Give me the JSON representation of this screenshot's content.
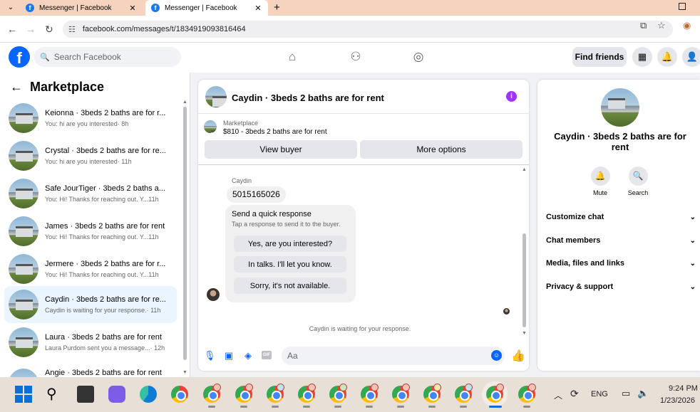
{
  "browser": {
    "tabs": [
      {
        "title": "Messenger | Facebook",
        "active": false
      },
      {
        "title": "Messenger | Facebook",
        "active": true
      }
    ],
    "url": "facebook.com/messages/t/1834919093816464"
  },
  "header": {
    "search_placeholder": "Search Facebook",
    "find_friends_label": "Find friends"
  },
  "sidebar": {
    "title": "Marketplace",
    "conversations": [
      {
        "name": "Keionna · 3beds 2 baths are for r...",
        "preview": "You: hi are you interested",
        "time": " · 8h",
        "selected": false
      },
      {
        "name": "Crystal · 3beds 2 baths are for re...",
        "preview": "You: hi are you interested",
        "time": " · 11h",
        "selected": false
      },
      {
        "name": "Safe JourTiger · 3beds 2 baths a...",
        "preview": "You: Hi! Thanks for reaching out. Y...",
        "time": " 11h",
        "selected": false
      },
      {
        "name": "James · 3beds 2 baths are for rent",
        "preview": "You: Hi! Thanks for reaching out. Y...",
        "time": " 11h",
        "selected": false
      },
      {
        "name": "Jermere · 3beds 2 baths are for r...",
        "preview": "You: Hi! Thanks for reaching out. Y...",
        "time": " 11h",
        "selected": false
      },
      {
        "name": "Caydin · 3beds 2 baths are for re...",
        "preview": "Caydin is waiting for your response.",
        "time": " · 11h",
        "selected": true
      },
      {
        "name": "Laura · 3beds 2 baths are for rent",
        "preview": "Laura Purdom sent you a message...",
        "time": " · 12h",
        "selected": false
      },
      {
        "name": "Angie · 3beds 2 baths are for rent",
        "preview": "",
        "time": "",
        "selected": false
      }
    ]
  },
  "chat": {
    "title": "Caydin · 3beds 2 baths are for rent",
    "marketplace_label": "Marketplace",
    "listing": "$810 - 3beds 2 baths are for rent",
    "view_buyer_label": "View buyer",
    "more_options_label": "More options",
    "sender_name": "Caydin",
    "phone_message": "5015165026",
    "quick_response": {
      "title": "Send a quick response",
      "subtitle": "Tap a response to send it to the buyer.",
      "options": [
        "Yes, are you interested?",
        "In talks. I'll let you know.",
        "Sorry, it's not available."
      ]
    },
    "waiting_status": "Caydin is waiting for your response.",
    "composer_placeholder": "Aa"
  },
  "details": {
    "name": "Caydin · 3beds 2 baths are for rent",
    "actions": [
      {
        "label": "Mute",
        "icon": "bell-icon"
      },
      {
        "label": "Search",
        "icon": "search-icon"
      }
    ],
    "sections": [
      "Customize chat",
      "Chat members",
      "Media, files and links",
      "Privacy & support"
    ]
  },
  "taskbar": {
    "language": "ENG",
    "time": "9:24 PM",
    "date": "1/23/2026"
  },
  "colors": {
    "brand": "#0866ff",
    "selected_row": "#ebf5ff",
    "info_accent": "#a033ff"
  }
}
